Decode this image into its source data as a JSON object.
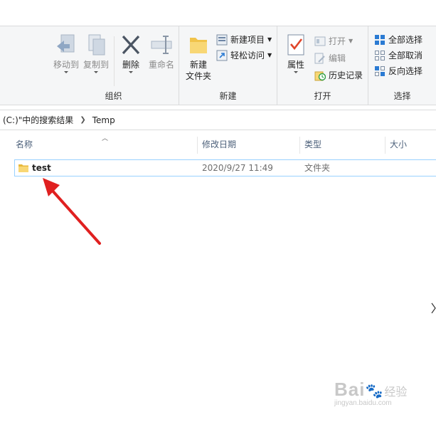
{
  "ribbon": {
    "organize": {
      "label": "组织",
      "move_to": "移动到",
      "copy_to": "复制到",
      "delete": "删除",
      "rename": "重命名"
    },
    "new": {
      "label": "新建",
      "new_folder_line1": "新建",
      "new_folder_line2": "文件夹",
      "new_item": "新建项目",
      "easy_access": "轻松访问"
    },
    "open": {
      "label": "打开",
      "properties": "属性",
      "open": "打开",
      "edit": "编辑",
      "history": "历史记录"
    },
    "select": {
      "label": "选择",
      "select_all": "全部选择",
      "select_none": "全部取消",
      "invert": "反向选择"
    }
  },
  "address": {
    "segment1": "(C:)\"中的搜索结果",
    "segment2": "Temp"
  },
  "columns": {
    "name": "名称",
    "modified": "修改日期",
    "type": "类型",
    "size": "大小"
  },
  "files": [
    {
      "name": "test",
      "modified": "2020/9/27 11:49",
      "type": "文件夹",
      "size": ""
    }
  ],
  "watermark": {
    "brand": "Bai",
    "brand2": "经验",
    "url": "jingyan.baidu.com"
  },
  "colors": {
    "accent_blue": "#2b7bd3",
    "selection_border": "#99d1ff",
    "folder_yellow": "#f8d775",
    "annotation_red": "#e02020"
  }
}
